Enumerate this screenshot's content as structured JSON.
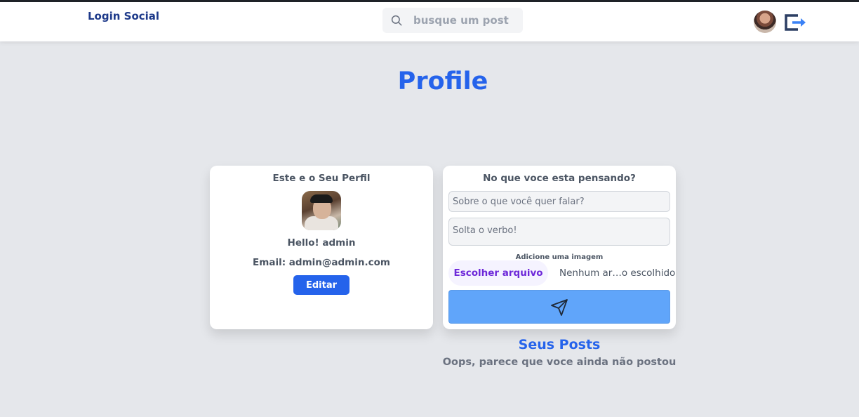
{
  "navbar": {
    "brand": "Login Social",
    "search_placeholder": "busque um post"
  },
  "page": {
    "title": "Profile"
  },
  "profile_card": {
    "heading": "Este e o Seu Perfil",
    "greeting": "Hello! admin",
    "email_line": "Email: admin@admin.com",
    "edit_label": "Editar"
  },
  "post_form": {
    "heading": "No que voce esta pensando?",
    "subject_placeholder": "Sobre o que você quer falar?",
    "body_placeholder": "Solta o verbo!",
    "image_label": "Adicione uma imagem",
    "file_button_label": "Escolher arquivo",
    "file_status": "Nenhum ar…o escolhido"
  },
  "posts": {
    "title": "Seus Posts",
    "empty_message": "Oops, parece que voce ainda não postou"
  },
  "colors": {
    "accent": "#2563eb",
    "send_button": "#60a5fa",
    "background": "#e5e7eb"
  }
}
